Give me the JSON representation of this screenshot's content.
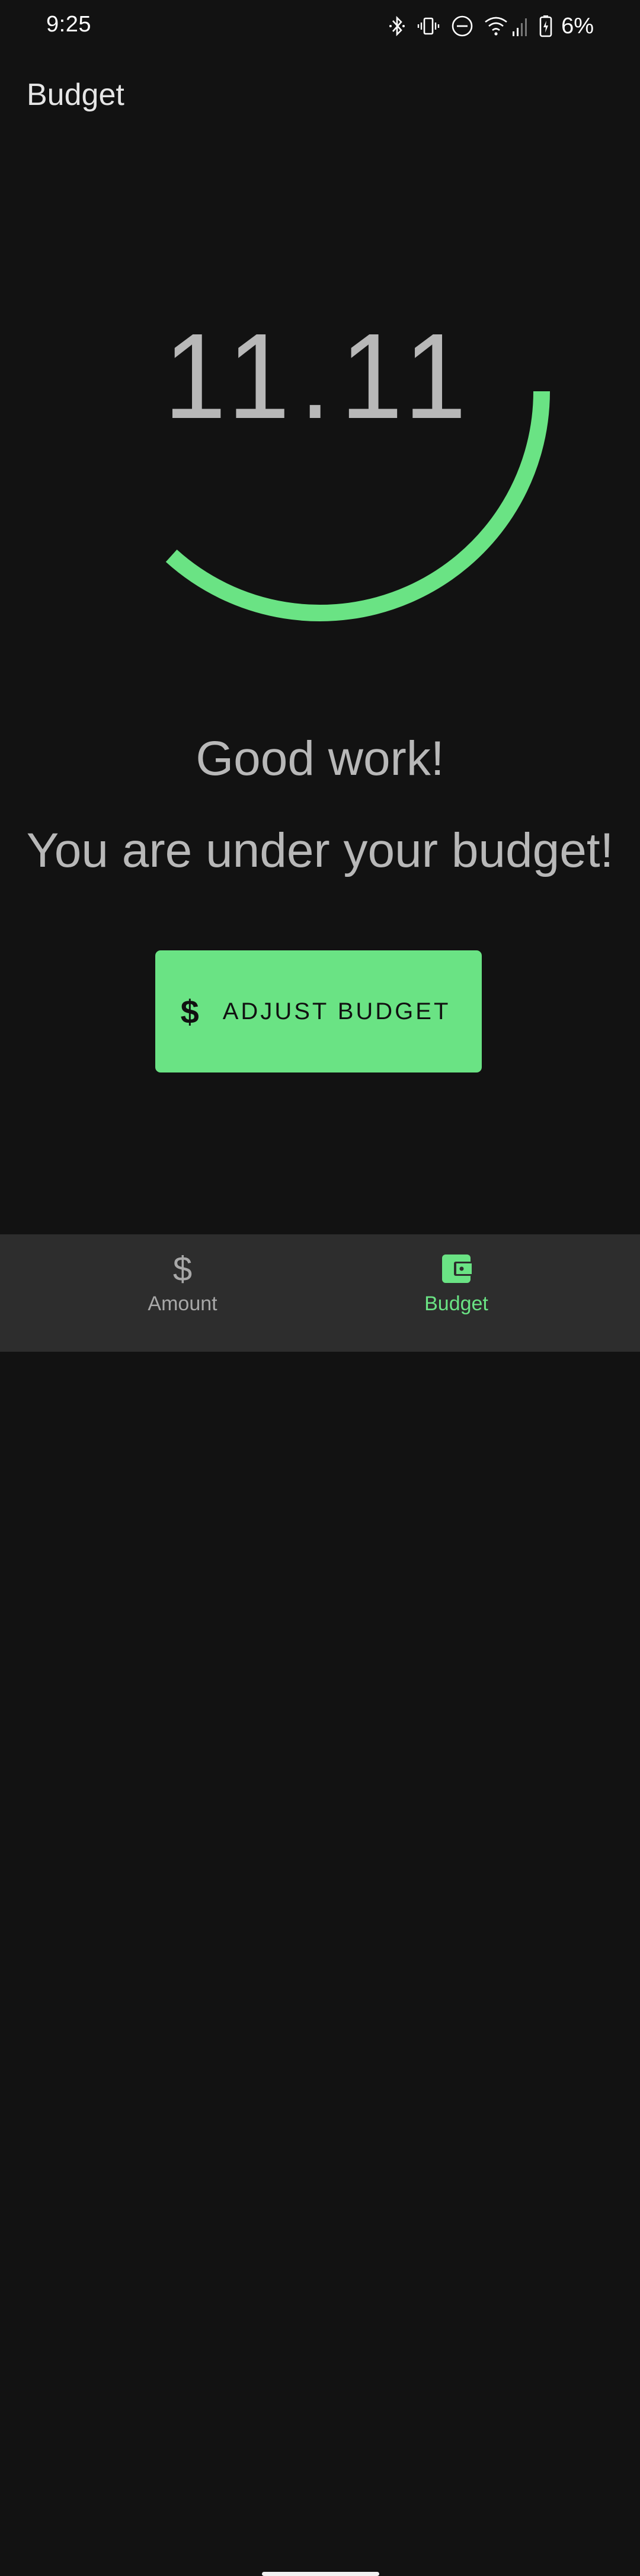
{
  "status_bar": {
    "time": "9:25",
    "icons": [
      "bluetooth-icon",
      "vibrate-icon",
      "do-not-disturb-icon",
      "wifi-icon",
      "cell-signal-icon",
      "battery-charging-icon"
    ],
    "battery_percent": "6%"
  },
  "app_bar": {
    "title": "Budget"
  },
  "gauge": {
    "value_text": "11.11",
    "progress_fraction": 0.367,
    "color": "#6ae384"
  },
  "messages": {
    "headline": "Good work!",
    "subline": "You are under your budget!"
  },
  "adjust_button": {
    "icon": "$",
    "label": "ADJUST BUDGET"
  },
  "bottom_nav": {
    "items": [
      {
        "label": "Amount",
        "icon": "dollar-icon",
        "icon_glyph": "$",
        "active": false
      },
      {
        "label": "Budget",
        "icon": "wallet-icon",
        "active": true
      }
    ],
    "active_color": "#6ae384",
    "inactive_color": "#a8a8a8"
  }
}
